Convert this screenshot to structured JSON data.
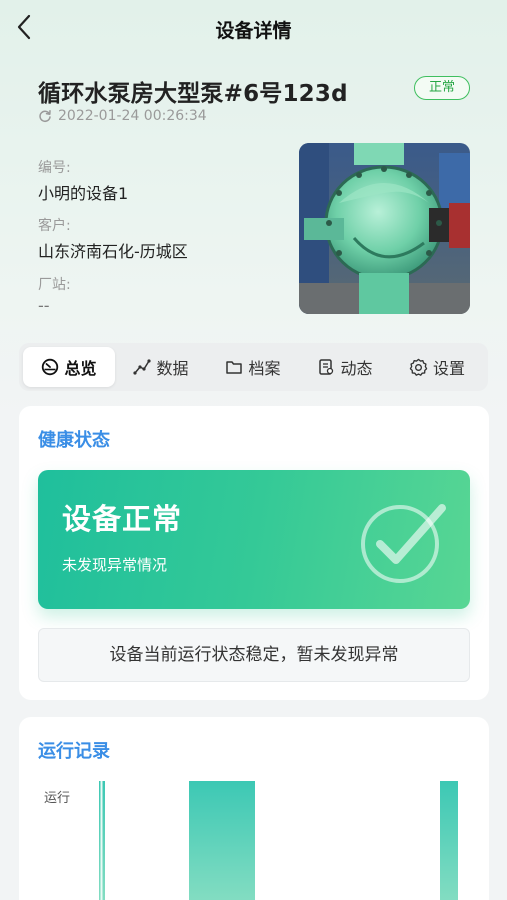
{
  "header": {
    "title": "设备详情"
  },
  "device": {
    "name": "循环水泵房大型泵#6号123d",
    "status": "正常",
    "timestamp": "2022-01-24 00:26:34",
    "fields": [
      {
        "label": "编号:",
        "value": "小明的设备1"
      },
      {
        "label": "客户:",
        "value": "山东济南石化-历城区"
      },
      {
        "label": "厂站:",
        "value": "--"
      }
    ]
  },
  "tabs": [
    {
      "label": "总览",
      "icon": "dashboard-icon",
      "active": true
    },
    {
      "label": "数据",
      "icon": "line-chart-icon",
      "active": false
    },
    {
      "label": "档案",
      "icon": "folder-icon",
      "active": false
    },
    {
      "label": "动态",
      "icon": "document-icon",
      "active": false
    },
    {
      "label": "设置",
      "icon": "gear-icon",
      "active": false
    }
  ],
  "health": {
    "section_title": "健康状态",
    "status_title": "设备正常",
    "status_subtitle": "未发现异常情况",
    "note": "设备当前运行状态稳定，暂未发现异常"
  },
  "run_record": {
    "section_title": "运行记录"
  },
  "chart_data": {
    "type": "bar",
    "series": [
      {
        "values": [
          "运行",
          "运行",
          "运行"
        ]
      }
    ],
    "ylabel_ticks": [
      "运行"
    ],
    "colors": {
      "top": "#3cc8b4",
      "bottom": "#8fe0c4"
    }
  },
  "colors": {
    "accent_blue": "#3a8ee6",
    "status_green": "#27a745",
    "banner_start": "#1fbf9c",
    "banner_end": "#58d694"
  }
}
